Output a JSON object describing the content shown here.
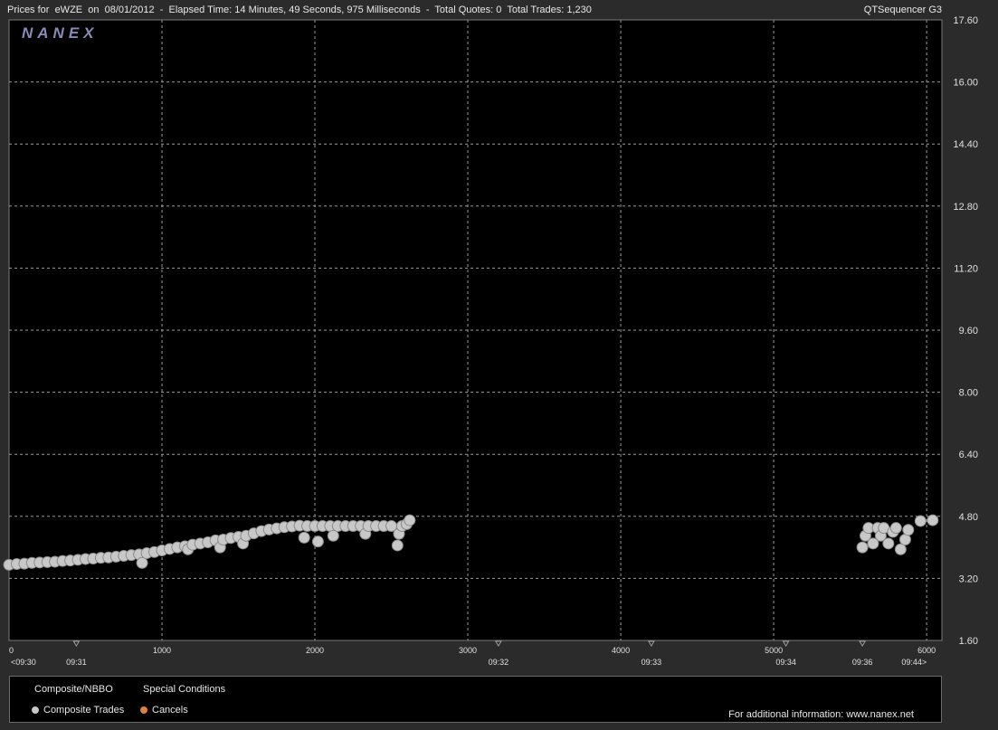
{
  "header": {
    "title": "Prices for  eWZE  on  08/01/2012  -  Elapsed Time: 14 Minutes, 49 Seconds, 975 Milliseconds  -  Total Quotes: 0  Total Trades: 1,230",
    "app_name": "QTSequencer G3"
  },
  "logo_text": "NANEX",
  "legend": {
    "composite_nbbo": "Composite/NBBO",
    "special_conditions": "Special Conditions",
    "composite_trades": "Composite Trades",
    "cancels": "Cancels",
    "info": "For additional information: www.nanex.net",
    "colors": {
      "trades": "#c8c8c8",
      "cancels": "#e0803a"
    }
  },
  "chart_data": {
    "type": "scatter",
    "title": "",
    "xlabel": "",
    "ylabel": "",
    "xlim": [
      0,
      6100
    ],
    "ylim": [
      1.6,
      17.6
    ],
    "x_ticks": [
      "0",
      "1000",
      "2000",
      "3000",
      "4000",
      "5000",
      "6000"
    ],
    "y_ticks": [
      "17.60",
      "16.00",
      "14.40",
      "12.80",
      "11.20",
      "9.60",
      "8.00",
      "6.40",
      "4.80",
      "3.20",
      "1.60"
    ],
    "time_labels": [
      {
        "x": 0,
        "label": "<09:30"
      },
      {
        "x": 440,
        "label": "09:31"
      },
      {
        "x": 3200,
        "label": "09:32"
      },
      {
        "x": 4200,
        "label": "09:33"
      },
      {
        "x": 5080,
        "label": "09:34"
      },
      {
        "x": 5580,
        "label": "09:36"
      },
      {
        "x": 6000,
        "label": "09:44>"
      }
    ],
    "grid": true,
    "series": [
      {
        "points": [
          [
            0,
            3.55
          ],
          [
            50,
            3.57
          ],
          [
            100,
            3.58
          ],
          [
            150,
            3.6
          ],
          [
            200,
            3.61
          ],
          [
            250,
            3.62
          ],
          [
            300,
            3.63
          ],
          [
            350,
            3.65
          ],
          [
            400,
            3.66
          ],
          [
            450,
            3.68
          ],
          [
            500,
            3.7
          ],
          [
            550,
            3.71
          ],
          [
            600,
            3.73
          ],
          [
            650,
            3.74
          ],
          [
            700,
            3.76
          ],
          [
            750,
            3.78
          ],
          [
            800,
            3.8
          ],
          [
            850,
            3.82
          ],
          [
            870,
            3.6
          ],
          [
            900,
            3.85
          ],
          [
            950,
            3.88
          ],
          [
            1000,
            3.92
          ],
          [
            1050,
            3.96
          ],
          [
            1100,
            4.0
          ],
          [
            1150,
            4.03
          ],
          [
            1170,
            3.95
          ],
          [
            1200,
            4.07
          ],
          [
            1250,
            4.1
          ],
          [
            1300,
            4.13
          ],
          [
            1350,
            4.18
          ],
          [
            1380,
            4.0
          ],
          [
            1400,
            4.2
          ],
          [
            1450,
            4.24
          ],
          [
            1500,
            4.27
          ],
          [
            1530,
            4.1
          ],
          [
            1550,
            4.3
          ],
          [
            1600,
            4.36
          ],
          [
            1650,
            4.42
          ],
          [
            1700,
            4.46
          ],
          [
            1750,
            4.49
          ],
          [
            1800,
            4.52
          ],
          [
            1850,
            4.54
          ],
          [
            1900,
            4.56
          ],
          [
            1930,
            4.25
          ],
          [
            1950,
            4.55
          ],
          [
            2000,
            4.55
          ],
          [
            2020,
            4.15
          ],
          [
            2050,
            4.55
          ],
          [
            2100,
            4.55
          ],
          [
            2120,
            4.3
          ],
          [
            2150,
            4.55
          ],
          [
            2200,
            4.55
          ],
          [
            2250,
            4.55
          ],
          [
            2300,
            4.55
          ],
          [
            2330,
            4.35
          ],
          [
            2350,
            4.55
          ],
          [
            2400,
            4.55
          ],
          [
            2450,
            4.55
          ],
          [
            2500,
            4.55
          ],
          [
            2540,
            4.05
          ],
          [
            2550,
            4.35
          ],
          [
            2570,
            4.55
          ],
          [
            2600,
            4.6
          ],
          [
            2620,
            4.7
          ],
          [
            5580,
            4.0
          ],
          [
            5600,
            4.3
          ],
          [
            5620,
            4.5
          ],
          [
            5650,
            4.1
          ],
          [
            5680,
            4.5
          ],
          [
            5700,
            4.3
          ],
          [
            5720,
            4.5
          ],
          [
            5750,
            4.1
          ],
          [
            5780,
            4.4
          ],
          [
            5800,
            4.5
          ],
          [
            5830,
            3.95
          ],
          [
            5860,
            4.2
          ],
          [
            5880,
            4.45
          ],
          [
            5960,
            4.68
          ],
          [
            6040,
            4.7
          ]
        ]
      }
    ]
  }
}
